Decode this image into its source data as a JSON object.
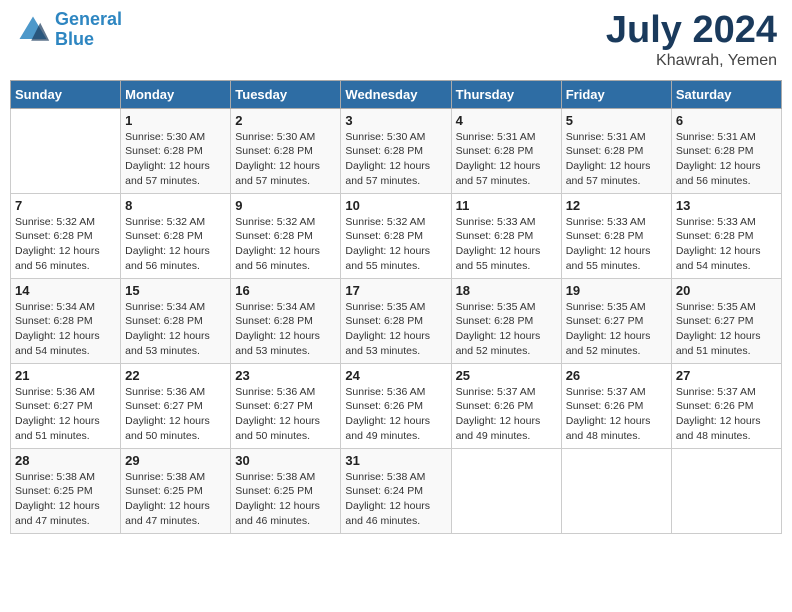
{
  "header": {
    "logo_line1": "General",
    "logo_line2": "Blue",
    "month": "July 2024",
    "location": "Khawrah, Yemen"
  },
  "days_of_week": [
    "Sunday",
    "Monday",
    "Tuesday",
    "Wednesday",
    "Thursday",
    "Friday",
    "Saturday"
  ],
  "weeks": [
    [
      {
        "day": "",
        "info": ""
      },
      {
        "day": "1",
        "info": "Sunrise: 5:30 AM\nSunset: 6:28 PM\nDaylight: 12 hours\nand 57 minutes."
      },
      {
        "day": "2",
        "info": "Sunrise: 5:30 AM\nSunset: 6:28 PM\nDaylight: 12 hours\nand 57 minutes."
      },
      {
        "day": "3",
        "info": "Sunrise: 5:30 AM\nSunset: 6:28 PM\nDaylight: 12 hours\nand 57 minutes."
      },
      {
        "day": "4",
        "info": "Sunrise: 5:31 AM\nSunset: 6:28 PM\nDaylight: 12 hours\nand 57 minutes."
      },
      {
        "day": "5",
        "info": "Sunrise: 5:31 AM\nSunset: 6:28 PM\nDaylight: 12 hours\nand 57 minutes."
      },
      {
        "day": "6",
        "info": "Sunrise: 5:31 AM\nSunset: 6:28 PM\nDaylight: 12 hours\nand 56 minutes."
      }
    ],
    [
      {
        "day": "7",
        "info": "Sunrise: 5:32 AM\nSunset: 6:28 PM\nDaylight: 12 hours\nand 56 minutes."
      },
      {
        "day": "8",
        "info": "Sunrise: 5:32 AM\nSunset: 6:28 PM\nDaylight: 12 hours\nand 56 minutes."
      },
      {
        "day": "9",
        "info": "Sunrise: 5:32 AM\nSunset: 6:28 PM\nDaylight: 12 hours\nand 56 minutes."
      },
      {
        "day": "10",
        "info": "Sunrise: 5:32 AM\nSunset: 6:28 PM\nDaylight: 12 hours\nand 55 minutes."
      },
      {
        "day": "11",
        "info": "Sunrise: 5:33 AM\nSunset: 6:28 PM\nDaylight: 12 hours\nand 55 minutes."
      },
      {
        "day": "12",
        "info": "Sunrise: 5:33 AM\nSunset: 6:28 PM\nDaylight: 12 hours\nand 55 minutes."
      },
      {
        "day": "13",
        "info": "Sunrise: 5:33 AM\nSunset: 6:28 PM\nDaylight: 12 hours\nand 54 minutes."
      }
    ],
    [
      {
        "day": "14",
        "info": "Sunrise: 5:34 AM\nSunset: 6:28 PM\nDaylight: 12 hours\nand 54 minutes."
      },
      {
        "day": "15",
        "info": "Sunrise: 5:34 AM\nSunset: 6:28 PM\nDaylight: 12 hours\nand 53 minutes."
      },
      {
        "day": "16",
        "info": "Sunrise: 5:34 AM\nSunset: 6:28 PM\nDaylight: 12 hours\nand 53 minutes."
      },
      {
        "day": "17",
        "info": "Sunrise: 5:35 AM\nSunset: 6:28 PM\nDaylight: 12 hours\nand 53 minutes."
      },
      {
        "day": "18",
        "info": "Sunrise: 5:35 AM\nSunset: 6:28 PM\nDaylight: 12 hours\nand 52 minutes."
      },
      {
        "day": "19",
        "info": "Sunrise: 5:35 AM\nSunset: 6:27 PM\nDaylight: 12 hours\nand 52 minutes."
      },
      {
        "day": "20",
        "info": "Sunrise: 5:35 AM\nSunset: 6:27 PM\nDaylight: 12 hours\nand 51 minutes."
      }
    ],
    [
      {
        "day": "21",
        "info": "Sunrise: 5:36 AM\nSunset: 6:27 PM\nDaylight: 12 hours\nand 51 minutes."
      },
      {
        "day": "22",
        "info": "Sunrise: 5:36 AM\nSunset: 6:27 PM\nDaylight: 12 hours\nand 50 minutes."
      },
      {
        "day": "23",
        "info": "Sunrise: 5:36 AM\nSunset: 6:27 PM\nDaylight: 12 hours\nand 50 minutes."
      },
      {
        "day": "24",
        "info": "Sunrise: 5:36 AM\nSunset: 6:26 PM\nDaylight: 12 hours\nand 49 minutes."
      },
      {
        "day": "25",
        "info": "Sunrise: 5:37 AM\nSunset: 6:26 PM\nDaylight: 12 hours\nand 49 minutes."
      },
      {
        "day": "26",
        "info": "Sunrise: 5:37 AM\nSunset: 6:26 PM\nDaylight: 12 hours\nand 48 minutes."
      },
      {
        "day": "27",
        "info": "Sunrise: 5:37 AM\nSunset: 6:26 PM\nDaylight: 12 hours\nand 48 minutes."
      }
    ],
    [
      {
        "day": "28",
        "info": "Sunrise: 5:38 AM\nSunset: 6:25 PM\nDaylight: 12 hours\nand 47 minutes."
      },
      {
        "day": "29",
        "info": "Sunrise: 5:38 AM\nSunset: 6:25 PM\nDaylight: 12 hours\nand 47 minutes."
      },
      {
        "day": "30",
        "info": "Sunrise: 5:38 AM\nSunset: 6:25 PM\nDaylight: 12 hours\nand 46 minutes."
      },
      {
        "day": "31",
        "info": "Sunrise: 5:38 AM\nSunset: 6:24 PM\nDaylight: 12 hours\nand 46 minutes."
      },
      {
        "day": "",
        "info": ""
      },
      {
        "day": "",
        "info": ""
      },
      {
        "day": "",
        "info": ""
      }
    ]
  ]
}
